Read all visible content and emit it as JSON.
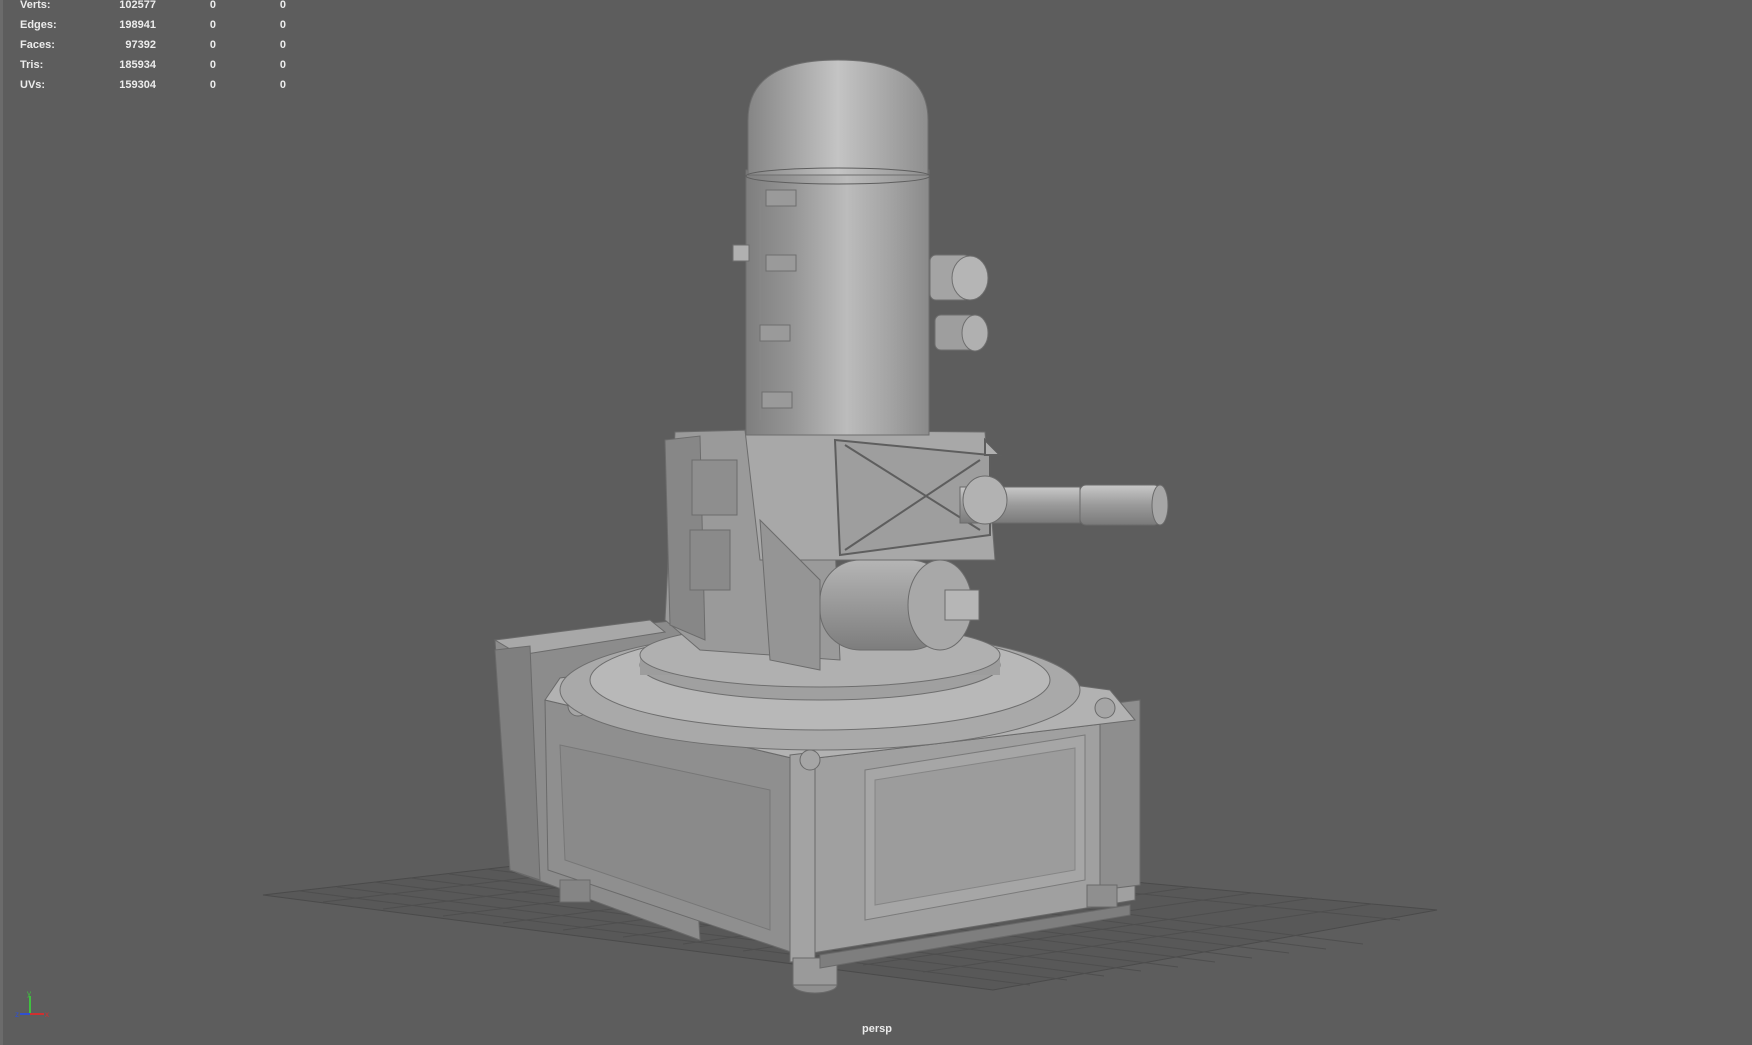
{
  "hud": {
    "stats": [
      {
        "label": "Verts:",
        "total": "102577",
        "selected": "0",
        "components": "0"
      },
      {
        "label": "Edges:",
        "total": "198941",
        "selected": "0",
        "components": "0"
      },
      {
        "label": "Faces:",
        "total": "97392",
        "selected": "0",
        "components": "0"
      },
      {
        "label": "Tris:",
        "total": "185934",
        "selected": "0",
        "components": "0"
      },
      {
        "label": "UVs:",
        "total": "159304",
        "selected": "0",
        "components": "0"
      }
    ]
  },
  "viewport": {
    "camera": "persp",
    "background_color": "#5d5d5d",
    "model_color": "#9a9a9a"
  },
  "axis_gizmo": {
    "labels": [
      "y",
      "z",
      "x"
    ],
    "colors": {
      "x": "#d03030",
      "y": "#40c040",
      "z": "#3050d0"
    }
  }
}
